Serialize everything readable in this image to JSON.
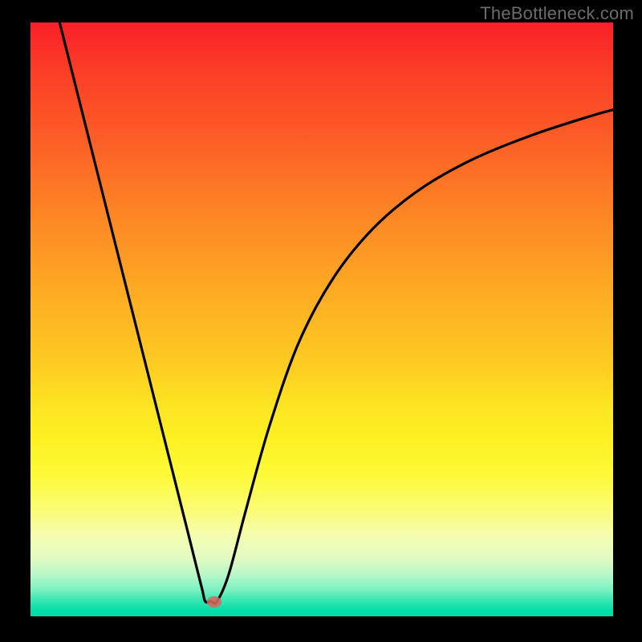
{
  "watermark": "TheBottleneck.com",
  "chart_data": {
    "type": "line",
    "title": "",
    "xlabel": "",
    "ylabel": "",
    "xlim": [
      0,
      100
    ],
    "ylim": [
      0,
      100
    ],
    "grid": false,
    "series": [
      {
        "name": "bottleneck-curve",
        "x": [
          5,
          10,
          15,
          20,
          23,
          25,
          27,
          28.5,
          29.5,
          30,
          31,
          32,
          34,
          37,
          41,
          46,
          52,
          59,
          67,
          76,
          86,
          96,
          100
        ],
        "y": [
          100,
          80.5,
          61,
          41.5,
          29.8,
          22,
          14.2,
          8.3,
          4.4,
          2.5,
          2.5,
          2.5,
          7,
          18,
          32,
          46,
          57,
          65.5,
          72,
          77,
          81,
          84.2,
          85.3
        ]
      }
    ],
    "marker": {
      "x": 31.5,
      "y": 2.5,
      "color": "#d16a5c"
    },
    "background_gradient": {
      "top": "#f92028",
      "mid": "#fde622",
      "bottom": "#00dba5"
    }
  }
}
